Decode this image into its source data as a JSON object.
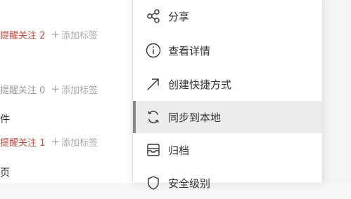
{
  "background_list": {
    "rows": [
      {
        "meta": {
          "reminder": "提醒关注 2",
          "reminder_zero": false,
          "add_tag": "添加标签"
        }
      },
      {
        "title": ""
      },
      {
        "meta": {
          "reminder": "提醒关注 0",
          "reminder_zero": true,
          "add_tag": "添加标签"
        }
      },
      {
        "title": "件"
      },
      {
        "meta": {
          "reminder": "提醒关注 1",
          "reminder_zero": false,
          "add_tag": "添加标签"
        }
      },
      {
        "title": "页"
      }
    ]
  },
  "menu": {
    "items": [
      {
        "label": "分享",
        "icon": "share-icon"
      },
      {
        "label": "查看详情",
        "icon": "info-icon"
      },
      {
        "label": "创建快捷方式",
        "icon": "shortcut-arrow-icon"
      },
      {
        "label": "同步到本地",
        "icon": "sync-icon",
        "active": true
      },
      {
        "label": "归档",
        "icon": "archive-icon"
      },
      {
        "label": "安全级别",
        "icon": "security-shield-icon"
      }
    ]
  },
  "colors": {
    "reminder": "#cc4a3c",
    "active_bg": "#ececec",
    "active_bar": "#8a8a8a"
  }
}
